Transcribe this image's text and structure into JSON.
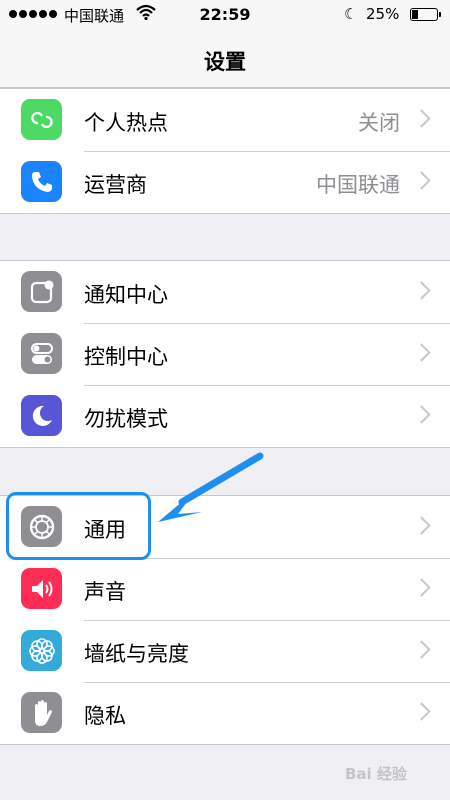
{
  "status_bar": {
    "carrier": "中国联通",
    "time": "22:59",
    "battery": "25%",
    "battery_level": 0.25
  },
  "nav": {
    "title": "设置"
  },
  "groups": [
    {
      "items": [
        {
          "label": "个人热点",
          "value": "关闭",
          "icon": "hotspot-icon",
          "color": "#4cd964"
        },
        {
          "label": "运营商",
          "value": "中国联通",
          "icon": "phone-icon",
          "color": "#1a84ff"
        }
      ]
    },
    {
      "items": [
        {
          "label": "通知中心",
          "value": "",
          "icon": "notification-icon",
          "color": "#8e8e93"
        },
        {
          "label": "控制中心",
          "value": "",
          "icon": "control-center-icon",
          "color": "#8e8e93"
        },
        {
          "label": "勿扰模式",
          "value": "",
          "icon": "moon-icon",
          "color": "#5856d6"
        }
      ]
    },
    {
      "items": [
        {
          "label": "通用",
          "value": "",
          "icon": "gear-icon",
          "color": "#8e8e93"
        },
        {
          "label": "声音",
          "value": "",
          "icon": "speaker-icon",
          "color": "#ff2d55"
        },
        {
          "label": "墙纸与亮度",
          "value": "",
          "icon": "flower-icon",
          "color": "#34aadc"
        },
        {
          "label": "隐私",
          "value": "",
          "icon": "hand-icon",
          "color": "#8e8e93"
        }
      ]
    }
  ],
  "annotation": {
    "color": "#1f8ef1"
  },
  "watermark": "Bai 经验"
}
